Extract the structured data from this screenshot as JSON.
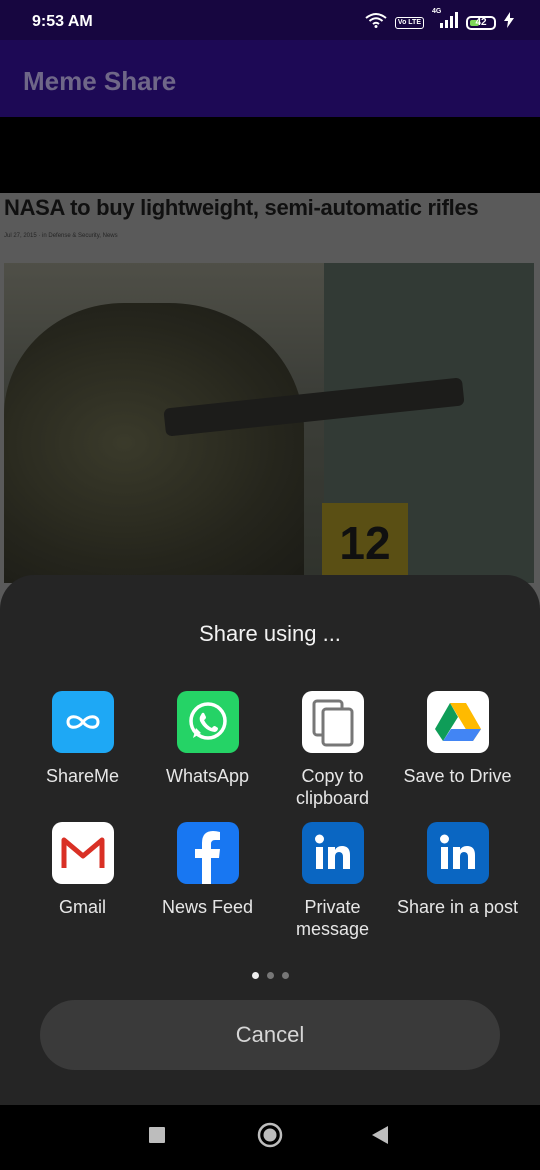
{
  "status_bar": {
    "time": "9:53 AM",
    "volte": "Vo LTE",
    "network": "4G",
    "battery": "42",
    "battery_level": 0.42,
    "icons": [
      "wifi-icon",
      "volte-icon",
      "signal-icon",
      "battery-icon",
      "charging-icon"
    ]
  },
  "app_bar": {
    "title": "Meme Share"
  },
  "meme": {
    "headline": "NASA to buy lightweight, semi-automatic rifles",
    "meta": "Jul 27, 2015 · in Defense & Security, News",
    "sign_number": "12"
  },
  "share_sheet": {
    "title": "Share using ...",
    "apps": [
      {
        "label": "ShareMe",
        "icon": "shareme-icon",
        "color": "#1ea8f5"
      },
      {
        "label": "WhatsApp",
        "icon": "whatsapp-icon",
        "color": "#25d366"
      },
      {
        "label": "Copy to clipboard",
        "icon": "copy-icon",
        "color": "#ffffff"
      },
      {
        "label": "Save to Drive",
        "icon": "google-drive-icon",
        "color": "#ffffff"
      },
      {
        "label": "Gmail",
        "icon": "gmail-icon",
        "color": "#ffffff"
      },
      {
        "label": "News Feed",
        "icon": "facebook-icon",
        "color": "#1877f2"
      },
      {
        "label": "Private message",
        "icon": "linkedin-icon",
        "color": "#0a66c2"
      },
      {
        "label": "Share in a post",
        "icon": "linkedin-icon",
        "color": "#0a66c2"
      }
    ],
    "page_count": 3,
    "active_page": 1,
    "cancel_label": "Cancel"
  },
  "nav_bar": {
    "icons": [
      "recents-icon",
      "home-icon",
      "back-icon"
    ]
  },
  "colors": {
    "status_bar": "#170640",
    "app_bar": "#1d0955",
    "sheet": "#252525"
  }
}
